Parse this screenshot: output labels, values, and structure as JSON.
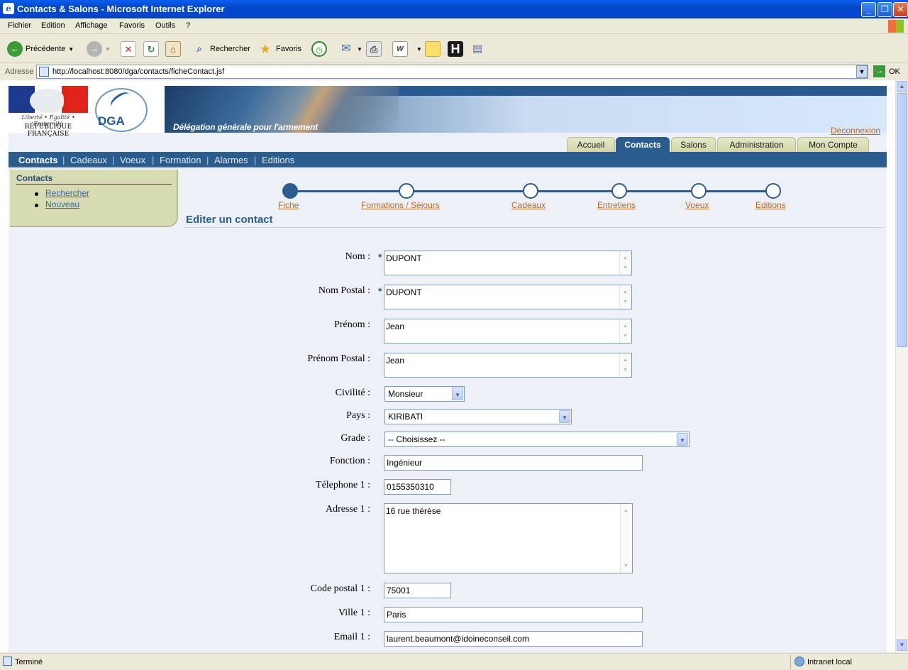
{
  "window": {
    "title": "Contacts & Salons - Microsoft Internet Explorer"
  },
  "menu": [
    "Fichier",
    "Edition",
    "Affichage",
    "Favoris",
    "Outils",
    "?"
  ],
  "toolbar": {
    "back": "Précédente",
    "search": "Rechercher",
    "favorites": "Favoris"
  },
  "address": {
    "label": "Adresse",
    "url": "http://localhost:8080/dga/contacts/ficheContact.jsf",
    "go": "OK"
  },
  "header": {
    "rf_motto": "Liberté • Égalité • Fraternité",
    "rf_name": "RÉPUBLIQUE FRANÇAISE",
    "dga": "DGA",
    "banner_title": "Délégation générale pour l'armement",
    "logout": "Déconnexion"
  },
  "tabs": [
    {
      "label": "Accueil",
      "active": false
    },
    {
      "label": "Contacts",
      "active": true
    },
    {
      "label": "Salons",
      "active": false
    },
    {
      "label": "Administration",
      "active": false
    },
    {
      "label": "Mon Compte",
      "active": false
    }
  ],
  "subnav": [
    "Contacts",
    "Cadeaux",
    "Voeux",
    "Formation",
    "Alarmes",
    "Editions"
  ],
  "sidebar": {
    "title": "Contacts",
    "links": [
      "Rechercher",
      "Nouveau"
    ]
  },
  "steps": [
    "Fiche",
    "Formations / Séjours",
    "Cadeaux",
    "Entretiens",
    "Voeux",
    "Editions"
  ],
  "form": {
    "title": "Editer un contact",
    "nom": {
      "label": "Nom :",
      "value": "DUPONT"
    },
    "nom_postal": {
      "label": "Nom Postal :",
      "value": "DUPONT"
    },
    "prenom": {
      "label": "Prénom :",
      "value": "Jean"
    },
    "prenom_postal": {
      "label": "Prénom Postal :",
      "value": "Jean"
    },
    "civilite": {
      "label": "Civilité :",
      "value": "Monsieur"
    },
    "pays": {
      "label": "Pays :",
      "value": "KIRIBATI"
    },
    "grade": {
      "label": "Grade :",
      "value": "-- Choisissez --"
    },
    "fonction": {
      "label": "Fonction :",
      "value": "Ingénieur"
    },
    "telephone1": {
      "label": "Télephone 1 :",
      "value": "0155350310"
    },
    "adresse1": {
      "label": "Adresse 1 :",
      "value": "16 rue thérèse"
    },
    "code_postal1": {
      "label": "Code postal 1 :",
      "value": "75001"
    },
    "ville1": {
      "label": "Ville 1 :",
      "value": "Paris"
    },
    "email1": {
      "label": "Email 1 :",
      "value": "laurent.beaumont@idoineconseil.com"
    },
    "required_mark": "*"
  },
  "status": {
    "left": "Terminé",
    "zone": "Intranet local"
  }
}
